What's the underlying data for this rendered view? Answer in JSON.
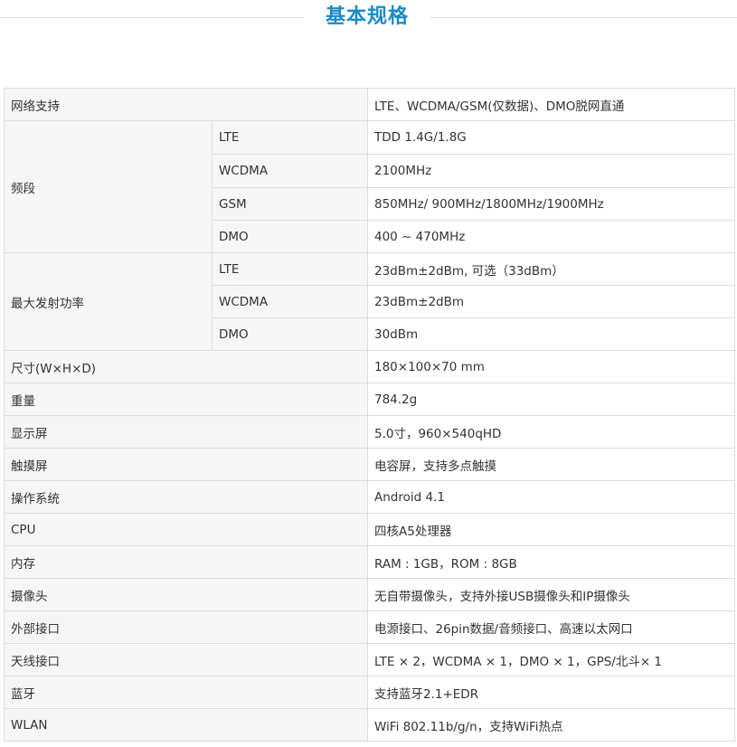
{
  "title": "基本规格",
  "rows": [
    {
      "label": "网络支持",
      "value": "LTE、WCDMA/GSM(仅数据)、DMO脱网直通"
    },
    {
      "label": "频段",
      "subs": [
        {
          "sub": "LTE",
          "value": "TDD 1.4G/1.8G"
        },
        {
          "sub": "WCDMA",
          "value": "2100MHz"
        },
        {
          "sub": "GSM",
          "value": "850MHz/ 900MHz/1800MHz/1900MHz"
        },
        {
          "sub": "DMO",
          "value": "400 ~ 470MHz"
        }
      ]
    },
    {
      "label": "最大发射功率",
      "subs": [
        {
          "sub": "LTE",
          "value": "23dBm±2dBm, 可选（33dBm）"
        },
        {
          "sub": "WCDMA",
          "value": "23dBm±2dBm"
        },
        {
          "sub": "DMO",
          "value": "30dBm"
        }
      ]
    },
    {
      "label": "尺寸(W×H×D)",
      "value": "180×100×70 mm"
    },
    {
      "label": "重量",
      "value": "784.2g"
    },
    {
      "label": "显示屏",
      "value": "5.0寸，960×540qHD"
    },
    {
      "label": "触摸屏",
      "value": "电容屏，支持多点触摸"
    },
    {
      "label": "操作系统",
      "value": "Android 4.1"
    },
    {
      "label": "CPU",
      "value": "四核A5处理器"
    },
    {
      "label": "内存",
      "value": "RAM : 1GB，ROM : 8GB"
    },
    {
      "label": "摄像头",
      "value": "无自带摄像头，支持外接USB摄像头和IP摄像头"
    },
    {
      "label": "外部接口",
      "value": "电源接口、26pin数据/音频接口、高速以太网口"
    },
    {
      "label": "天线接口",
      "value": "LTE × 2，WCDMA × 1，DMO × 1，GPS/北斗× 1"
    },
    {
      "label": "蓝牙",
      "value": "支持蓝牙2.1+EDR"
    },
    {
      "label": "WLAN",
      "value": "WiFi 802.11b/g/n，支持WiFi热点"
    }
  ]
}
